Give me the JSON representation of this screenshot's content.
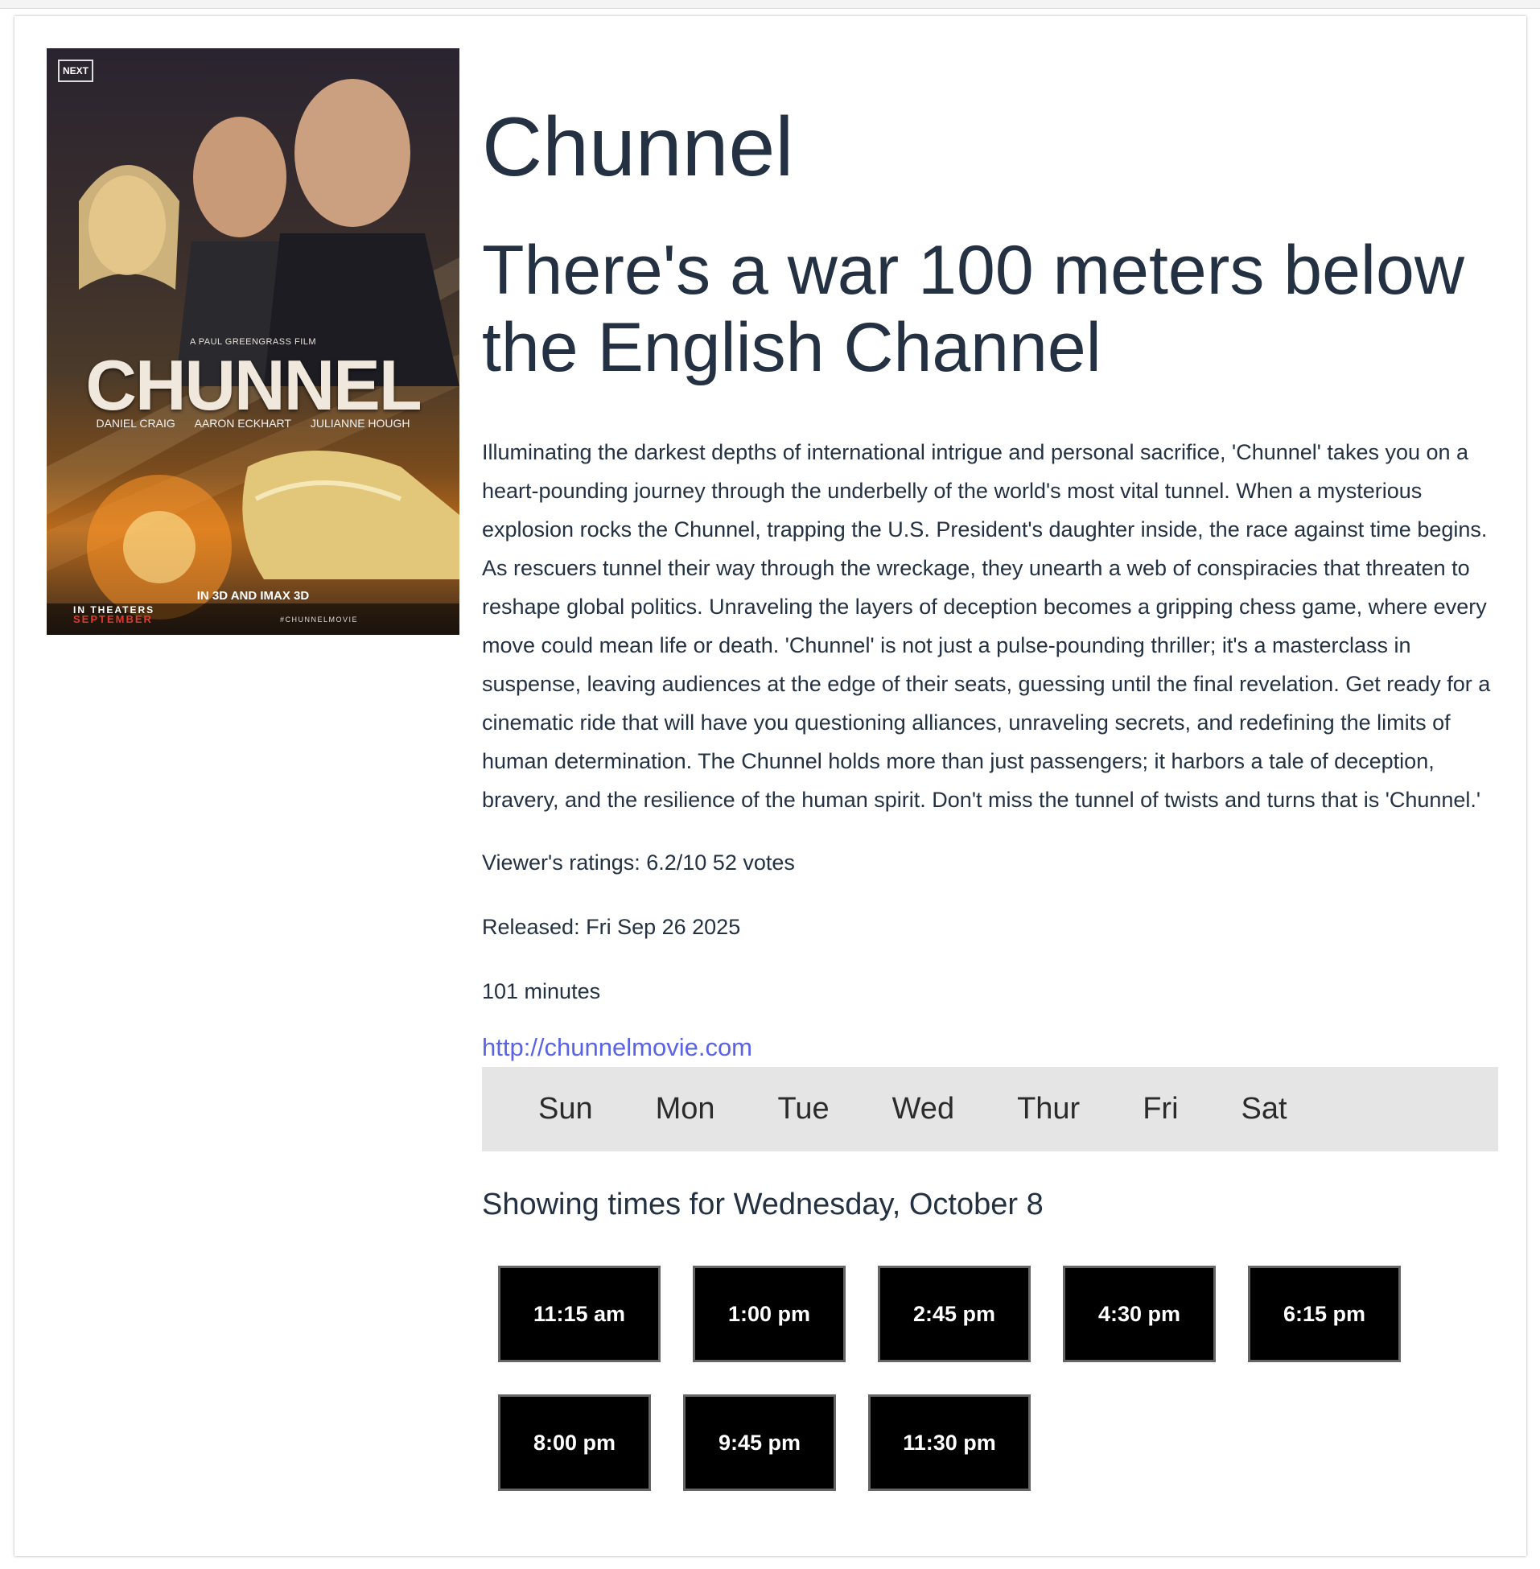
{
  "poster": {
    "logo": "NEXT",
    "director_credit": "A PAUL GREENGRASS FILM",
    "title": "CHUNNEL",
    "cast": [
      "DANIEL CRAIG",
      "AARON ECKHART",
      "JULIANNE HOUGH"
    ],
    "format": "IN 3D AND IMAX 3D",
    "theaters_line": "IN THEATERS",
    "theaters_month": "SEPTEMBER",
    "hashtag": "#CHUNNELMOVIE"
  },
  "movie": {
    "title": "Chunnel",
    "tagline": "There's a war 100 meters below the English Channel",
    "description": "Illuminating the darkest depths of international intrigue and personal sacrifice, 'Chunnel' takes you on a heart-pounding journey through the underbelly of the world's most vital tunnel. When a mysterious explosion rocks the Chunnel, trapping the U.S. President's daughter inside, the race against time begins. As rescuers tunnel their way through the wreckage, they unearth a web of conspiracies that threaten to reshape global politics. Unraveling the layers of deception becomes a gripping chess game, where every move could mean life or death. 'Chunnel' is not just a pulse-pounding thriller; it's a masterclass in suspense, leaving audiences at the edge of their seats, guessing until the final revelation. Get ready for a cinematic ride that will have you questioning alliances, unraveling secrets, and redefining the limits of human determination. The Chunnel holds more than just passengers; it harbors a tale of deception, bravery, and the resilience of the human spirit. Don't miss the tunnel of twists and turns that is 'Chunnel.'",
    "ratings": "Viewer's ratings: 6.2/10 52 votes",
    "released": "Released: Fri Sep 26 2025",
    "runtime": "101 minutes",
    "website": "http://chunnelmovie.com"
  },
  "days": [
    "Sun",
    "Mon",
    "Tue",
    "Wed",
    "Thur",
    "Fri",
    "Sat"
  ],
  "showing_heading": "Showing times for Wednesday, October 8",
  "showtimes": [
    "11:15 am",
    "1:00 pm",
    "2:45 pm",
    "4:30 pm",
    "6:15 pm",
    "8:00 pm",
    "9:45 pm",
    "11:30 pm"
  ],
  "colors": {
    "text": "#233142",
    "link": "#5a63e6",
    "day_bar": "#e5e5e5",
    "button_bg": "#000000"
  }
}
